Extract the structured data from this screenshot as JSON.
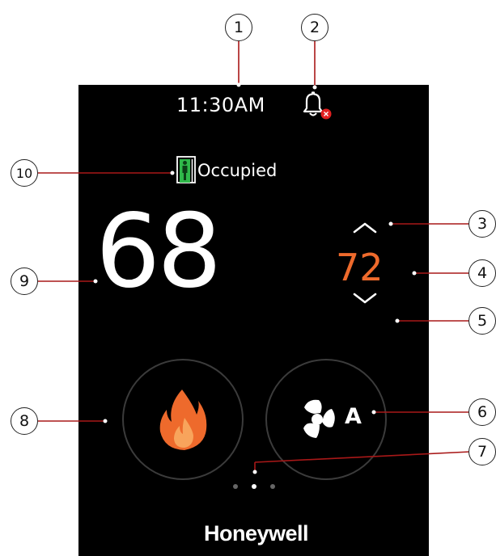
{
  "status_bar": {
    "time": "11:30AM",
    "bell_icon": "bell-alert-icon"
  },
  "occupancy": {
    "label": "Occupied",
    "icon": "occupied-person-icon"
  },
  "temperature": {
    "current": "68",
    "setpoint": "72",
    "setpoint_color": "#ee6a2c"
  },
  "controls": {
    "system_mode_icon": "flame-icon",
    "fan_mode_icon": "fan-icon",
    "fan_mode_label": "A"
  },
  "pagination": {
    "page_count": 3,
    "active_page": 2
  },
  "brand": "Honeywell",
  "callouts": [
    "1",
    "2",
    "3",
    "4",
    "5",
    "6",
    "7",
    "8",
    "9",
    "10"
  ]
}
